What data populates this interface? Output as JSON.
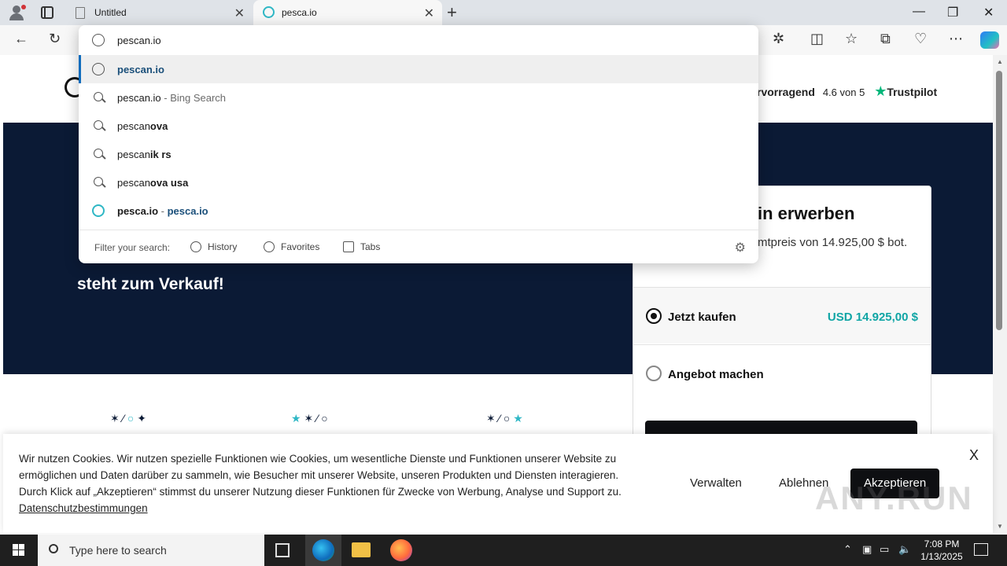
{
  "browser": {
    "tabs": [
      {
        "label": "Untitled"
      },
      {
        "label": "pesca.io"
      }
    ],
    "window_controls": {
      "minimize": "—",
      "restore": "❐",
      "close": "✕"
    }
  },
  "omnibox": {
    "input_value": "pescan.io",
    "suggestions": [
      {
        "prefix": "",
        "main": "pescan.io",
        "suffix": "",
        "type": "url"
      },
      {
        "prefix": "pescan.io",
        "main": "",
        "suffix": " - Bing Search",
        "type": "search"
      },
      {
        "prefix": "pescan",
        "main": "ova",
        "suffix": "",
        "type": "search"
      },
      {
        "prefix": "pescan",
        "main": "ik rs",
        "suffix": "",
        "type": "search"
      },
      {
        "prefix": "pescan",
        "main": "ova usa",
        "suffix": "",
        "type": "search"
      },
      {
        "prefix": "pesca.io",
        "main": "",
        "suffix": "pesca.io",
        "type": "site"
      }
    ],
    "site_separator": " - ",
    "filter": {
      "label": "Filter your search:",
      "history": "History",
      "favorites": "Favorites",
      "tabs": "Tabs"
    }
  },
  "site": {
    "rating_word": "rvorragend",
    "rating_value": "4.6 von 5",
    "trustpilot": "Trustpilot",
    "hero_title": "steht zum Verkauf!",
    "buybox": {
      "title": "in erwerben",
      "subtitle": "mtpreis von 14.925,00 $ bot.",
      "option_buy": "Jetzt kaufen",
      "option_buy_price": "USD 14.925,00 $",
      "option_offer": "Angebot machen"
    }
  },
  "cookie": {
    "text": "Wir nutzen Cookies. Wir nutzen spezielle Funktionen wie Cookies, um wesentliche Dienste und Funktionen unserer Website zu ermöglichen und Daten darüber zu sammeln, wie Besucher mit unserer Website, unseren Produkten und Diensten interagieren. Durch Klick auf „Akzeptieren“ stimmst du unserer Nutzung dieser Funktionen für Zwecke von Werbung, Analyse und Support zu.",
    "privacy_link": "Datenschutzbestimmungen",
    "manage": "Verwalten",
    "reject": "Ablehnen",
    "accept": "Akzeptieren",
    "close": "X"
  },
  "watermark": "ANY.RUN",
  "taskbar": {
    "search_placeholder": "Type here to search",
    "time": "7:08 PM",
    "date": "1/13/2025"
  },
  "colors": {
    "hero_bg": "#0b1a35",
    "accent_teal": "#10a5a5",
    "trustpilot_green": "#00b67a"
  }
}
